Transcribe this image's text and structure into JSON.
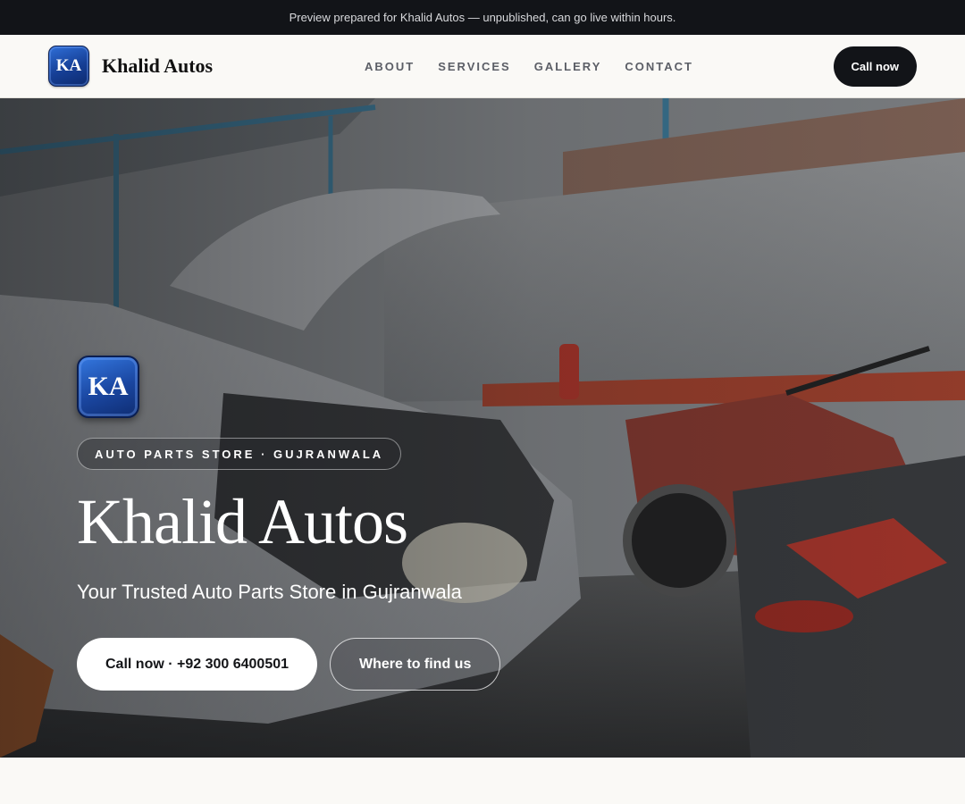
{
  "preview_bar": {
    "text": "Preview prepared for Khalid Autos — unpublished, can go live within hours."
  },
  "brand": {
    "logo_text": "KA",
    "name": "Khalid Autos"
  },
  "nav": {
    "links": [
      "ABOUT",
      "SERVICES",
      "GALLERY",
      "CONTACT"
    ],
    "cta_label": "Call now"
  },
  "hero": {
    "logo_text": "KA",
    "eyebrow": "AUTO PARTS STORE · GUJRANWALA",
    "title": "Khalid Autos",
    "subtitle": "Your Trusted Auto Parts Store in Gujranwala",
    "primary_button": "Call now · +92 300 6400501",
    "secondary_button": "Where to find us",
    "background_image": "garage-photo"
  },
  "colors": {
    "dark": "#121418",
    "accent_blue": "#1a46a0",
    "page_bg": "#faf9f6"
  }
}
